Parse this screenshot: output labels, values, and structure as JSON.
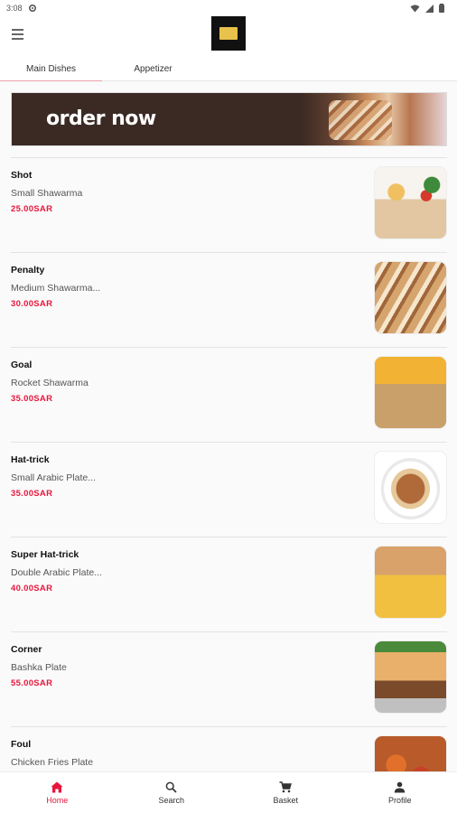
{
  "status_bar": {
    "time": "3:08"
  },
  "tabs": [
    {
      "label": "Main Dishes",
      "active": true
    },
    {
      "label": "Appetizer",
      "active": false
    }
  ],
  "banner": {
    "text": "order now"
  },
  "items": [
    {
      "name": "Shot",
      "description": "Small Shawarma",
      "price": "25.00SAR"
    },
    {
      "name": "Penalty",
      "description": "Medium Shawarma...",
      "price": "30.00SAR"
    },
    {
      "name": "Goal",
      "description": "Rocket Shawarma",
      "price": "35.00SAR"
    },
    {
      "name": "Hat-trick",
      "description": "Small Arabic Plate...",
      "price": "35.00SAR"
    },
    {
      "name": "Super Hat-trick",
      "description": "Double Arabic Plate...",
      "price": "40.00SAR"
    },
    {
      "name": "Corner",
      "description": "Bashka Plate",
      "price": "55.00SAR"
    },
    {
      "name": "Foul",
      "description": "Chicken Fries Plate",
      "price": ""
    }
  ],
  "bottom_nav": [
    {
      "label": "Home",
      "icon": "home-icon",
      "active": true
    },
    {
      "label": "Search",
      "icon": "search-icon",
      "active": false
    },
    {
      "label": "Basket",
      "icon": "cart-icon",
      "active": false
    },
    {
      "label": "Profile",
      "icon": "person-icon",
      "active": false
    }
  ],
  "colors": {
    "accent": "#e8163c",
    "tab_indicator": "#f0a0a8",
    "banner_bg": "#3b2a24"
  }
}
